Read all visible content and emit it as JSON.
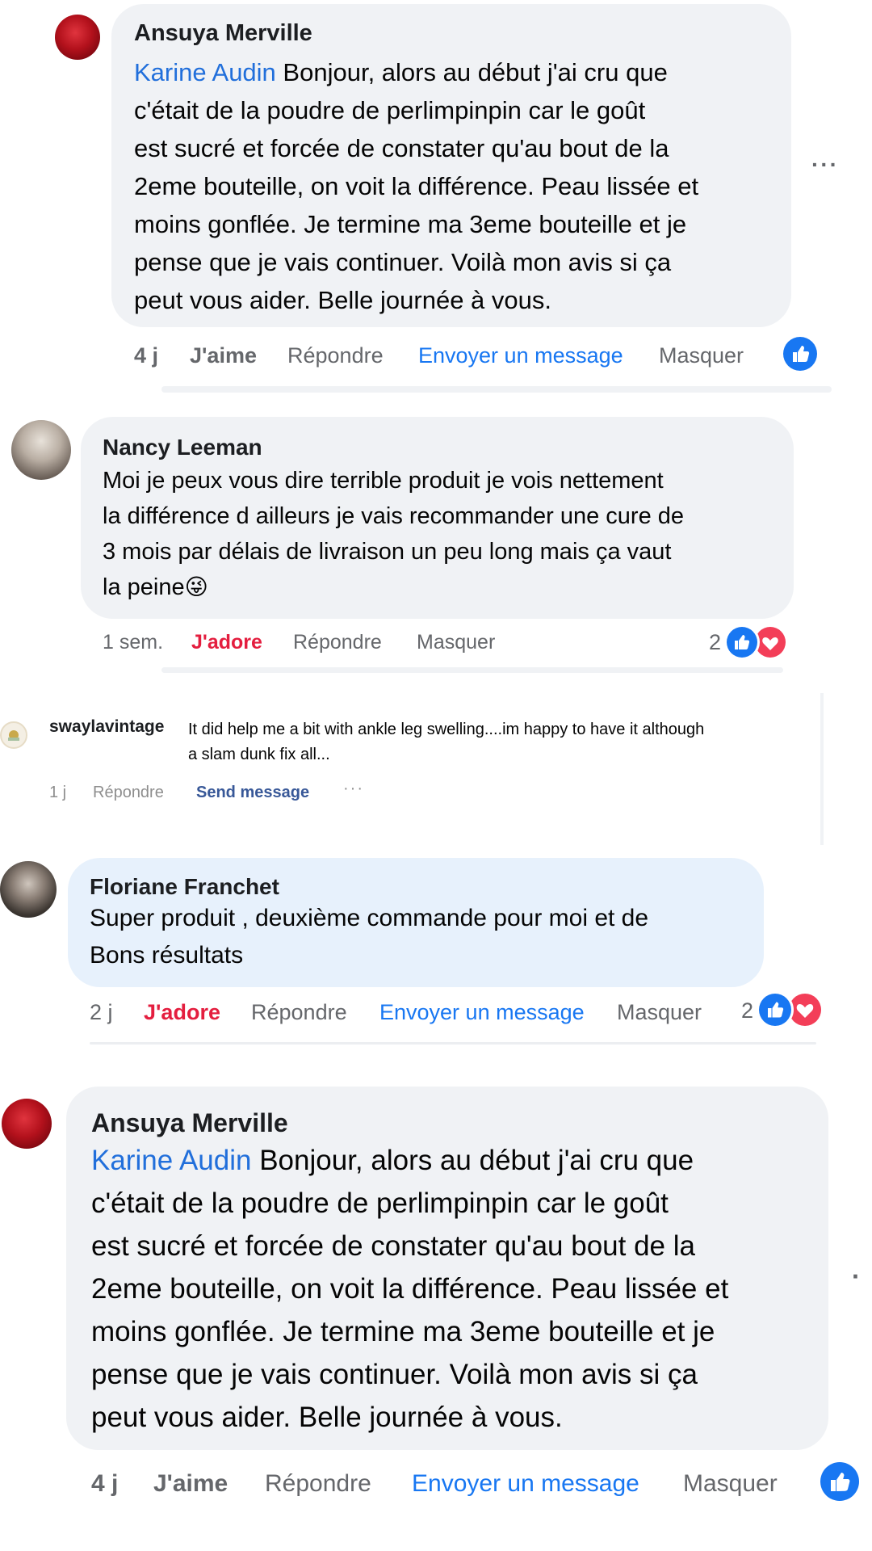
{
  "comments": [
    {
      "author": "Ansuya Merville",
      "mention": "Karine Audin",
      "lines": [
        " Bonjour, alors au début j'ai cru que",
        "c'était de la poudre de perlimpinpin car le goût",
        "est sucré et forcée de constater qu'au bout de la",
        "2eme bouteille, on voit la différence. Peau lissée et",
        "moins gonflée. Je termine ma 3eme bouteille et je",
        "pense que je vais continuer. Voilà mon avis si ça",
        "peut vous aider. Belle journée à vous."
      ],
      "time": "4 j",
      "reaction": "J'aime",
      "reply": "Répondre",
      "message": "Envoyer un message",
      "hide": "Masquer",
      "more": "···"
    },
    {
      "author": "Nancy Leeman",
      "lines": [
        "Moi je peux vous dire terrible produit je vois nettement",
        "la différence d ailleurs je vais recommander une cure de",
        "3 mois par délais de livraison un peu long mais ça vaut",
        "la peine"
      ],
      "emoji": "😜",
      "time": "1 sem.",
      "reaction": "J'adore",
      "reply": "Répondre",
      "hide": "Masquer",
      "reaction_count": "2"
    },
    {
      "author": "swaylavintage",
      "lines": [
        "It did help me a bit with ankle leg swelling....im happy to have it although",
        "a slam dunk fix all..."
      ],
      "time": "1 j",
      "reply": "Répondre",
      "message": "Send message",
      "more": "···"
    },
    {
      "author": "Floriane Franchet",
      "lines": [
        "Super produit , deuxième commande pour moi et de",
        "Bons résultats"
      ],
      "time": "2 j",
      "reaction": "J'adore",
      "reply": "Répondre",
      "message": "Envoyer un message",
      "hide": "Masquer",
      "reaction_count": "2"
    },
    {
      "author": "Ansuya Merville",
      "mention": "Karine Audin",
      "lines": [
        " Bonjour, alors au début j'ai cru que",
        "c'était de la poudre de perlimpinpin car le goût",
        "est sucré et forcée de constater qu'au bout de la",
        "2eme bouteille, on voit la différence. Peau lissée et",
        "moins gonflée. Je termine ma 3eme bouteille et je",
        "pense que je vais continuer. Voilà mon avis si ça",
        "peut vous aider. Belle journée à vous."
      ],
      "time": "4 j",
      "reaction": "J'aime",
      "reply": "Répondre",
      "message": "Envoyer un message",
      "hide": "Masquer",
      "more": "·"
    }
  ],
  "colors": {
    "bubble_grey": "#f0f2f5",
    "bubble_blue": "#e7f1fc",
    "mention": "#216fdb",
    "like": "#1877f2",
    "love": "#e41e3f",
    "muted": "#65676b"
  },
  "icons": {
    "like": "thumbs-up-icon",
    "love": "heart-icon",
    "more": "more-options-icon"
  }
}
